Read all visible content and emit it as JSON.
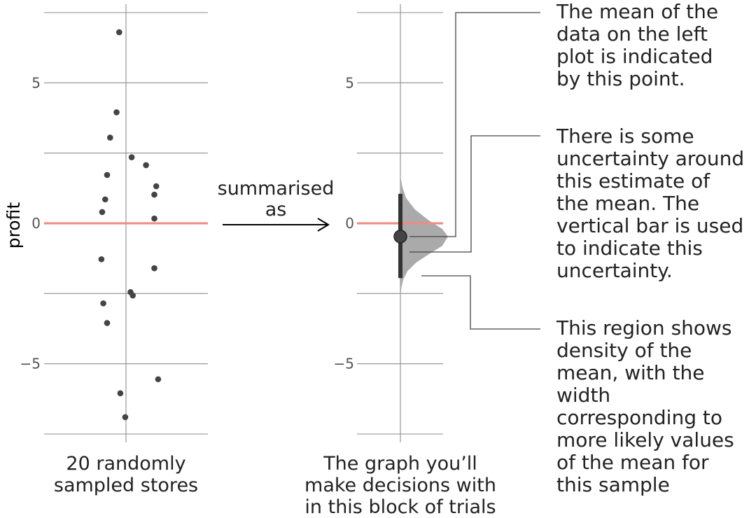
{
  "chart_data": [
    {
      "type": "scatter",
      "ylabel": "profit",
      "caption_lines": [
        "20 randomly",
        "sampled stores"
      ],
      "yticks": [
        5,
        0,
        -5
      ],
      "ytick_labels": [
        "5",
        "0",
        "−5"
      ],
      "ylim": [
        -7.5,
        7.5
      ],
      "grid": true,
      "reference_line": {
        "y": 0,
        "color": "#f08a80"
      },
      "points": [
        {
          "x": -0.18,
          "y": 6.8
        },
        {
          "x": -0.25,
          "y": 3.95
        },
        {
          "x": -0.42,
          "y": 3.05
        },
        {
          "x": 0.15,
          "y": 2.35
        },
        {
          "x": 0.53,
          "y": 2.07
        },
        {
          "x": -0.5,
          "y": 1.72
        },
        {
          "x": 0.8,
          "y": 1.32
        },
        {
          "x": 0.75,
          "y": 1.02
        },
        {
          "x": -0.55,
          "y": 0.85
        },
        {
          "x": -0.63,
          "y": 0.4
        },
        {
          "x": 0.75,
          "y": 0.17
        },
        {
          "x": -0.65,
          "y": -1.28
        },
        {
          "x": 0.75,
          "y": -1.6
        },
        {
          "x": 0.12,
          "y": -2.45
        },
        {
          "x": 0.18,
          "y": -2.57
        },
        {
          "x": -0.6,
          "y": -2.85
        },
        {
          "x": -0.5,
          "y": -3.55
        },
        {
          "x": 0.85,
          "y": -5.55
        },
        {
          "x": -0.15,
          "y": -6.05
        },
        {
          "x": -0.02,
          "y": -6.9
        }
      ]
    },
    {
      "type": "interval",
      "caption_lines": [
        "The graph you’ll",
        "make decisions with",
        "in this block of trials"
      ],
      "yticks": [
        5,
        0,
        -5
      ],
      "ytick_labels": [
        "5",
        "0",
        "−5"
      ],
      "ylim": [
        -7.5,
        7.5
      ],
      "grid": true,
      "reference_line": {
        "y": 0,
        "color": "#f08a80"
      },
      "mean": -0.47,
      "interval": [
        -1.95,
        1.05
      ],
      "density": {
        "y": [
          1.7,
          1.3,
          0.9,
          0.5,
          0.1,
          -0.2,
          -0.47,
          -0.8,
          -1.1,
          -1.4,
          -1.7,
          -2.0,
          -2.3,
          -2.6
        ],
        "width": [
          0.0,
          0.04,
          0.12,
          0.3,
          0.6,
          0.88,
          1.0,
          0.88,
          0.6,
          0.33,
          0.15,
          0.06,
          0.02,
          0.0
        ]
      },
      "density_color": "#aaaaaa",
      "bar_color": "#333333"
    }
  ],
  "middle_label": {
    "lines": [
      "summarised",
      "as"
    ]
  },
  "annotations": [
    {
      "lines": [
        "The mean of the",
        "data on the left",
        "plot is indicated",
        "by this point."
      ]
    },
    {
      "lines": [
        "There is some",
        "uncertainty around",
        "this estimate of",
        "the mean. The",
        "vertical bar is used",
        "to indicate this",
        "uncertainty."
      ]
    },
    {
      "lines": [
        "This region shows",
        "density of the",
        "mean, with the",
        "width",
        "corresponding to",
        "more likely values",
        "of the mean for",
        "this sample"
      ]
    }
  ]
}
